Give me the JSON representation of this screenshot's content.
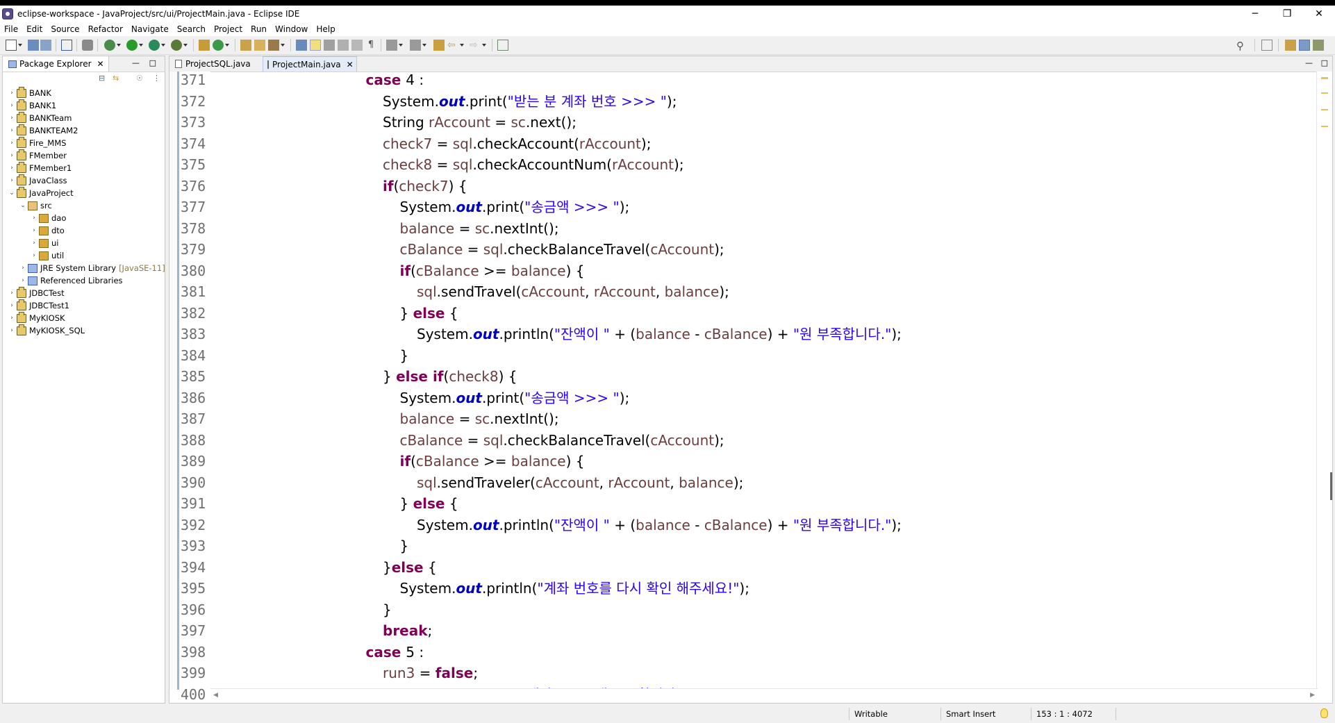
{
  "window": {
    "title": "eclipse-workspace - JavaProject/src/ui/ProjectMain.java - Eclipse IDE"
  },
  "menu": [
    "File",
    "Edit",
    "Source",
    "Refactor",
    "Navigate",
    "Search",
    "Project",
    "Run",
    "Window",
    "Help"
  ],
  "left_panel": {
    "tab_label": "Package Explorer",
    "tree": [
      {
        "label": "BANK",
        "level": 0,
        "icon": "project-icon",
        "chevron": "›"
      },
      {
        "label": "BANK1",
        "level": 0,
        "icon": "project-icon",
        "chevron": "›"
      },
      {
        "label": "BANKTeam",
        "level": 0,
        "icon": "project-icon",
        "chevron": "›"
      },
      {
        "label": "BANKTEAM2",
        "level": 0,
        "icon": "project-icon",
        "chevron": "›"
      },
      {
        "label": "Fire_MMS",
        "level": 0,
        "icon": "project-icon",
        "chevron": "›"
      },
      {
        "label": "FMember",
        "level": 0,
        "icon": "project-icon",
        "chevron": "›"
      },
      {
        "label": "FMember1",
        "level": 0,
        "icon": "project-icon",
        "chevron": "›"
      },
      {
        "label": "JavaClass",
        "level": 0,
        "icon": "project-icon",
        "chevron": "›"
      },
      {
        "label": "JavaProject",
        "level": 0,
        "icon": "project-icon",
        "chevron": "⌄"
      },
      {
        "label": "src",
        "level": 1,
        "icon": "source-folder-icon",
        "chevron": "⌄"
      },
      {
        "label": "dao",
        "level": 2,
        "icon": "package-icon",
        "chevron": "›"
      },
      {
        "label": "dto",
        "level": 2,
        "icon": "package-icon",
        "chevron": "›"
      },
      {
        "label": "ui",
        "level": 2,
        "icon": "package-icon",
        "chevron": "›"
      },
      {
        "label": "util",
        "level": 2,
        "icon": "package-icon",
        "chevron": "›"
      },
      {
        "label": "JRE System Library",
        "extra": "[JavaSE-11]",
        "level": 1,
        "icon": "library-icon",
        "chevron": "›"
      },
      {
        "label": "Referenced Libraries",
        "level": 1,
        "icon": "library-icon",
        "chevron": "›"
      },
      {
        "label": "JDBCTest",
        "level": 0,
        "icon": "project-icon",
        "chevron": "›"
      },
      {
        "label": "JDBCTest1",
        "level": 0,
        "icon": "project-icon",
        "chevron": "›"
      },
      {
        "label": "MyKIOSK",
        "level": 0,
        "icon": "project-icon",
        "chevron": "›"
      },
      {
        "label": "MyKIOSK_SQL",
        "level": 0,
        "icon": "project-icon",
        "chevron": "›"
      }
    ]
  },
  "editor": {
    "tabs": [
      {
        "label": "ProjectSQL.java",
        "active": false
      },
      {
        "label": "ProjectMain.java",
        "active": true
      }
    ],
    "lines": [
      {
        "n": "371",
        "indent": 9,
        "t": [
          [
            "kw",
            "case "
          ],
          [
            "",
            "4 :"
          ]
        ]
      },
      {
        "n": "372",
        "indent": 10,
        "t": [
          [
            "",
            "System."
          ],
          [
            "fld",
            "out"
          ],
          [
            "",
            ".print("
          ],
          [
            "st",
            "\"받는 분 계좌 번호 >>> \""
          ],
          [
            "",
            ");"
          ]
        ]
      },
      {
        "n": "373",
        "indent": 10,
        "t": [
          [
            "",
            "String "
          ],
          [
            "var",
            "rAccount"
          ],
          [
            "",
            " = "
          ],
          [
            "var",
            "sc"
          ],
          [
            "",
            ".next();"
          ]
        ]
      },
      {
        "n": "374",
        "indent": 10,
        "t": [
          [
            "var",
            "check7"
          ],
          [
            "",
            " = "
          ],
          [
            "var",
            "sql"
          ],
          [
            "",
            ".checkAccount("
          ],
          [
            "var",
            "rAccount"
          ],
          [
            "",
            ");"
          ]
        ]
      },
      {
        "n": "375",
        "indent": 10,
        "t": [
          [
            "var",
            "check8"
          ],
          [
            "",
            " = "
          ],
          [
            "var",
            "sql"
          ],
          [
            "",
            ".checkAccountNum("
          ],
          [
            "var",
            "rAccount"
          ],
          [
            "",
            ");"
          ]
        ]
      },
      {
        "n": "376",
        "indent": 10,
        "t": [
          [
            "kw",
            "if"
          ],
          [
            "",
            "("
          ],
          [
            "var",
            "check7"
          ],
          [
            "",
            ") {"
          ]
        ]
      },
      {
        "n": "377",
        "indent": 11,
        "t": [
          [
            "",
            "System."
          ],
          [
            "fld",
            "out"
          ],
          [
            "",
            ".print("
          ],
          [
            "st",
            "\"송금액 >>> \""
          ],
          [
            "",
            ");"
          ]
        ]
      },
      {
        "n": "378",
        "indent": 11,
        "t": [
          [
            "var",
            "balance"
          ],
          [
            "",
            " = "
          ],
          [
            "var",
            "sc"
          ],
          [
            "",
            ".nextInt();"
          ]
        ]
      },
      {
        "n": "379",
        "indent": 11,
        "t": [
          [
            "var",
            "cBalance"
          ],
          [
            "",
            " = "
          ],
          [
            "var",
            "sql"
          ],
          [
            "",
            ".checkBalanceTravel("
          ],
          [
            "var",
            "cAccount"
          ],
          [
            "",
            ");"
          ]
        ]
      },
      {
        "n": "380",
        "indent": 11,
        "t": [
          [
            "kw",
            "if"
          ],
          [
            "",
            "("
          ],
          [
            "var",
            "cBalance"
          ],
          [
            "",
            " >= "
          ],
          [
            "var",
            "balance"
          ],
          [
            "",
            ") {"
          ]
        ]
      },
      {
        "n": "381",
        "indent": 12,
        "t": [
          [
            "var",
            "sql"
          ],
          [
            "",
            ".sendTravel("
          ],
          [
            "var",
            "cAccount"
          ],
          [
            "",
            ", "
          ],
          [
            "var",
            "rAccount"
          ],
          [
            "",
            ", "
          ],
          [
            "var",
            "balance"
          ],
          [
            "",
            ");"
          ]
        ]
      },
      {
        "n": "382",
        "indent": 11,
        "t": [
          [
            "",
            "} "
          ],
          [
            "kw",
            "else"
          ],
          [
            "",
            " {"
          ]
        ]
      },
      {
        "n": "383",
        "indent": 12,
        "t": [
          [
            "",
            "System."
          ],
          [
            "fld",
            "out"
          ],
          [
            "",
            ".println("
          ],
          [
            "st",
            "\"잔액이 \""
          ],
          [
            "",
            " + ("
          ],
          [
            "var",
            "balance"
          ],
          [
            "",
            " - "
          ],
          [
            "var",
            "cBalance"
          ],
          [
            "",
            ") + "
          ],
          [
            "st",
            "\"원 부족합니다.\""
          ],
          [
            "",
            ");"
          ]
        ]
      },
      {
        "n": "384",
        "indent": 11,
        "t": [
          [
            "",
            "}"
          ]
        ]
      },
      {
        "n": "385",
        "indent": 10,
        "t": [
          [
            "",
            "} "
          ],
          [
            "kw",
            "else if"
          ],
          [
            "",
            "("
          ],
          [
            "var",
            "check8"
          ],
          [
            "",
            ") {"
          ]
        ]
      },
      {
        "n": "386",
        "indent": 11,
        "t": [
          [
            "",
            "System."
          ],
          [
            "fld",
            "out"
          ],
          [
            "",
            ".print("
          ],
          [
            "st",
            "\"송금액 >>> \""
          ],
          [
            "",
            ");"
          ]
        ]
      },
      {
        "n": "387",
        "indent": 11,
        "t": [
          [
            "var",
            "balance"
          ],
          [
            "",
            " = "
          ],
          [
            "var",
            "sc"
          ],
          [
            "",
            ".nextInt();"
          ]
        ]
      },
      {
        "n": "388",
        "indent": 11,
        "t": [
          [
            "var",
            "cBalance"
          ],
          [
            "",
            " = "
          ],
          [
            "var",
            "sql"
          ],
          [
            "",
            ".checkBalanceTravel("
          ],
          [
            "var",
            "cAccount"
          ],
          [
            "",
            ");"
          ]
        ]
      },
      {
        "n": "389",
        "indent": 11,
        "t": [
          [
            "kw",
            "if"
          ],
          [
            "",
            "("
          ],
          [
            "var",
            "cBalance"
          ],
          [
            "",
            " >= "
          ],
          [
            "var",
            "balance"
          ],
          [
            "",
            ") {"
          ]
        ]
      },
      {
        "n": "390",
        "indent": 12,
        "t": [
          [
            "var",
            "sql"
          ],
          [
            "",
            ".sendTraveler("
          ],
          [
            "var",
            "cAccount"
          ],
          [
            "",
            ", "
          ],
          [
            "var",
            "rAccount"
          ],
          [
            "",
            ", "
          ],
          [
            "var",
            "balance"
          ],
          [
            "",
            ");"
          ]
        ]
      },
      {
        "n": "391",
        "indent": 11,
        "t": [
          [
            "",
            "} "
          ],
          [
            "kw",
            "else"
          ],
          [
            "",
            " {"
          ]
        ]
      },
      {
        "n": "392",
        "indent": 12,
        "t": [
          [
            "",
            "System."
          ],
          [
            "fld",
            "out"
          ],
          [
            "",
            ".println("
          ],
          [
            "st",
            "\"잔액이 \""
          ],
          [
            "",
            " + ("
          ],
          [
            "var",
            "balance"
          ],
          [
            "",
            " - "
          ],
          [
            "var",
            "cBalance"
          ],
          [
            "",
            ") + "
          ],
          [
            "st",
            "\"원 부족합니다.\""
          ],
          [
            "",
            ");"
          ]
        ]
      },
      {
        "n": "393",
        "indent": 11,
        "t": [
          [
            "",
            "}"
          ]
        ]
      },
      {
        "n": "394",
        "indent": 10,
        "t": [
          [
            "",
            "}"
          ],
          [
            "kw",
            "else"
          ],
          [
            "",
            " {"
          ]
        ]
      },
      {
        "n": "395",
        "indent": 11,
        "t": [
          [
            "",
            "System."
          ],
          [
            "fld",
            "out"
          ],
          [
            "",
            ".println("
          ],
          [
            "st",
            "\"계좌 번호를 다시 확인 해주세요!\""
          ],
          [
            "",
            ");"
          ]
        ]
      },
      {
        "n": "396",
        "indent": 10,
        "t": [
          [
            "",
            "}"
          ]
        ]
      },
      {
        "n": "397",
        "indent": 10,
        "t": [
          [
            "kw",
            "break"
          ],
          [
            "",
            ";"
          ]
        ]
      },
      {
        "n": "398",
        "indent": 9,
        "t": [
          [
            "kw",
            "case "
          ],
          [
            "",
            "5 :"
          ]
        ]
      },
      {
        "n": "399",
        "indent": 10,
        "t": [
          [
            "var",
            "run3"
          ],
          [
            "",
            " = "
          ],
          [
            "kw",
            "false"
          ],
          [
            "",
            ";"
          ]
        ]
      },
      {
        "n": "400",
        "indent": 10,
        "t": [
          [
            "",
            "System."
          ],
          [
            "fld",
            "out"
          ],
          [
            "",
            ".println("
          ],
          [
            "st",
            "\"계좌 프로그램 종료합니다.\""
          ],
          [
            "",
            ");"
          ]
        ]
      }
    ]
  },
  "status": {
    "writable": "Writable",
    "insert_mode": "Smart Insert",
    "position": "153 : 1 : 4072"
  },
  "colors": {
    "keyword": "#7f0055",
    "string": "#2a00ff",
    "field": "#0000c0",
    "variable": "#6a3e3e"
  }
}
